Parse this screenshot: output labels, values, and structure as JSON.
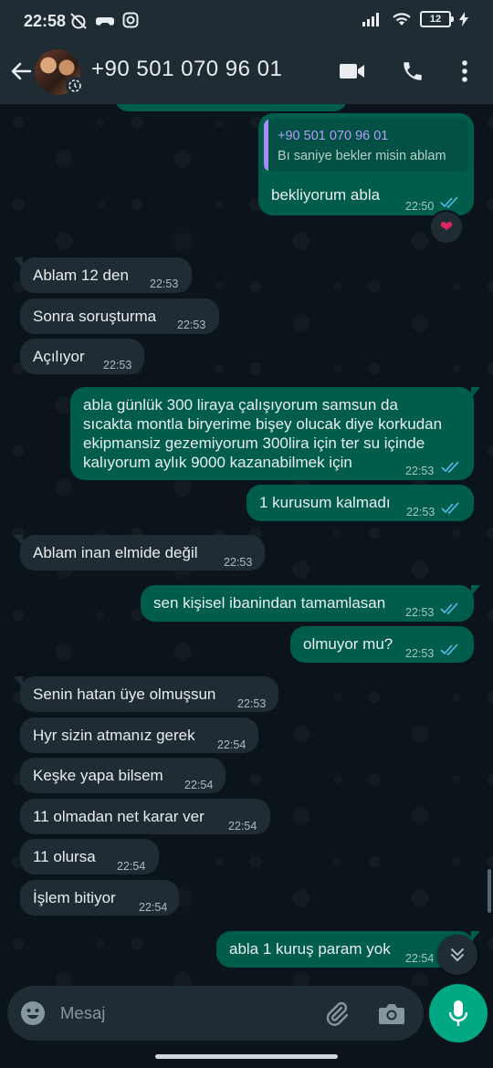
{
  "status_bar": {
    "time": "22:58",
    "battery": "12"
  },
  "header": {
    "contact_name": "+90 501 070 96 01"
  },
  "messages": [
    {
      "dir": "out",
      "reply_to_name": "+90 501 070 96 01",
      "reply_to_text": "Bı saniye bekler misin ablam",
      "text": "bekliyorum abla",
      "time": "22:50",
      "reaction": "❤"
    },
    {
      "dir": "in",
      "text": "Ablam 12 den",
      "time": "22:53"
    },
    {
      "dir": "in",
      "text": "Sonra soruşturma",
      "time": "22:53"
    },
    {
      "dir": "in",
      "text": "Açılıyor",
      "time": "22:53"
    },
    {
      "dir": "out",
      "lines": [
        "abla günlük 300 liraya çalışıyorum samsun da",
        "sıcakta montla biryerime bişey olucak diye korkudan",
        "ekipmansiz gezemiyorum 300lira için ter su içinde",
        "kalıyorum aylık 9000 kazanabilmek için"
      ],
      "time": "22:53"
    },
    {
      "dir": "out",
      "text": "1 kurusum kalmadı",
      "time": "22:53"
    },
    {
      "dir": "in",
      "text": "Ablam inan elmide değil",
      "time": "22:53"
    },
    {
      "dir": "out",
      "text": "sen kişisel ibanindan tamamlasan",
      "time": "22:53"
    },
    {
      "dir": "out",
      "text": "olmuyor mu?",
      "time": "22:53"
    },
    {
      "dir": "in",
      "text": "Senin hatan üye olmuşsun",
      "time": "22:53"
    },
    {
      "dir": "in",
      "text": "Hyr sizin atmanız gerek",
      "time": "22:54"
    },
    {
      "dir": "in",
      "text": "Keşke yapa bilsem",
      "time": "22:54"
    },
    {
      "dir": "in",
      "text": "11 olmadan net karar ver",
      "time": "22:54"
    },
    {
      "dir": "in",
      "text": "11 olursa",
      "time": "22:54"
    },
    {
      "dir": "in",
      "text": "İşlem bitiyor",
      "time": "22:54"
    },
    {
      "dir": "out",
      "text": "abla 1 kuruş param yok",
      "time": "22:54"
    }
  ],
  "input": {
    "placeholder": "Mesaj"
  },
  "colors": {
    "incoming_bubble": "#1f2c34",
    "outgoing_bubble": "#005c4b",
    "accent": "#00a884",
    "read_ticks": "#53bdeb"
  }
}
